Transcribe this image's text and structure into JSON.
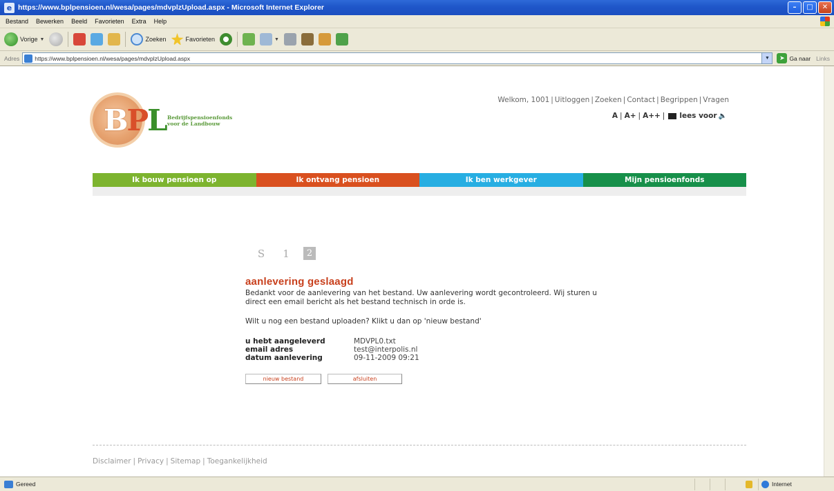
{
  "window": {
    "title": "https://www.bplpensioen.nl/wesa/pages/mdvplzUpload.aspx - Microsoft Internet Explorer"
  },
  "menu": [
    "Bestand",
    "Bewerken",
    "Beeld",
    "Favorieten",
    "Extra",
    "Help"
  ],
  "toolbar": {
    "back_label": "Vorige",
    "search_label": "Zoeken",
    "favorites_label": "Favorieten"
  },
  "address": {
    "label": "Adres",
    "url": "https://www.bplpensioen.nl/wesa/pages/mdvplzUpload.aspx",
    "go_label": "Ga naar",
    "links_label": "Links"
  },
  "site": {
    "logo_text": "BPL",
    "logo_tagline": "Bedrijfspensioenfonds voor de Landbouw",
    "top_links": [
      "Welkom, 1001",
      "Uitloggen",
      "Zoeken",
      "Contact",
      "Begrippen",
      "Vragen"
    ],
    "font_sizes": [
      "A",
      "A+",
      "A++"
    ],
    "listen_label": "lees voor",
    "nav": [
      "Ik bouw pensioen op",
      "Ik ontvang pensioen",
      "Ik ben werkgever",
      "Mijn pensioenfonds"
    ],
    "steps": [
      "S",
      "1",
      "2"
    ]
  },
  "content": {
    "title": "aanlevering geslaagd",
    "text": "Bedankt voor de aanlevering van het bestand. Uw aanlevering wordt gecontroleerd. Wij sturen u direct een email bericht als het bestand technisch in orde is.",
    "question": "Wilt u nog een bestand uploaden? Klikt u dan op 'nieuw bestand'",
    "info": [
      {
        "label": "u hebt aangeleverd",
        "value": "MDVPL0.txt"
      },
      {
        "label": "email adres",
        "value": "test@interpolis.nl"
      },
      {
        "label": "datum aanlevering",
        "value": "09-11-2009 09:21"
      }
    ],
    "btn_new": "nieuw bestand",
    "btn_close": "afsluiten"
  },
  "footer": [
    "Disclaimer",
    "Privacy",
    "Sitemap",
    "Toegankelijkheid"
  ],
  "status": {
    "text": "Gereed",
    "zone": "Internet"
  },
  "colors": {
    "nav_green": "#7db42f",
    "nav_red": "#d9501f",
    "nav_blue": "#27aee2",
    "nav_dark_green": "#17904a",
    "title_red": "#c8401d"
  }
}
